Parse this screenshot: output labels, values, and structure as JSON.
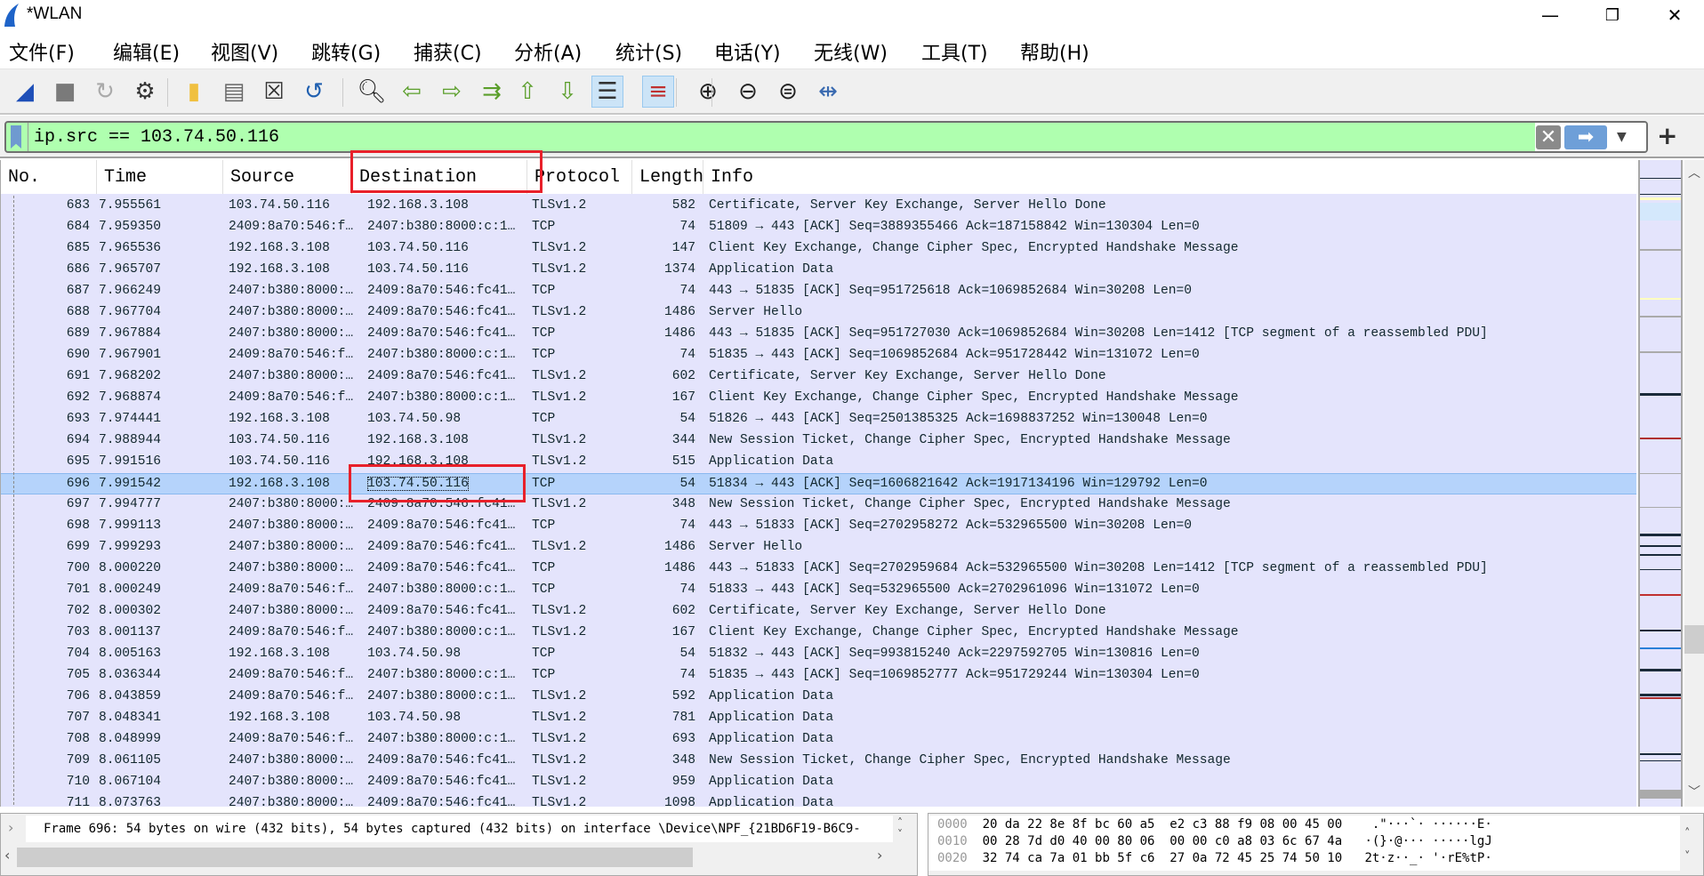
{
  "window": {
    "title": "*WLAN",
    "min_icon": "minimize-icon",
    "max_icon": "restore-icon",
    "close_icon": "close-icon"
  },
  "menu": [
    "文件(F)",
    "编辑(E)",
    "视图(V)",
    "跳转(G)",
    "捕获(C)",
    "分析(A)",
    "统计(S)",
    "电话(Y)",
    "无线(W)",
    "工具(T)",
    "帮助(H)"
  ],
  "toolbar": [
    "start-capture-icon",
    "stop-capture-icon",
    "restart-capture-icon",
    "capture-options-icon",
    "open-file-icon",
    "save-file-icon",
    "close-file-icon",
    "reload-file-icon",
    "find-packet-icon",
    "go-back-icon",
    "go-forward-icon",
    "go-to-packet-icon",
    "first-packet-icon",
    "last-packet-icon",
    "autoscroll-icon",
    "colorize-icon",
    "zoom-in-icon",
    "zoom-out-icon",
    "normal-size-icon",
    "resize-columns-icon"
  ],
  "filter": {
    "value": "ip.src == 103.74.50.116",
    "add_label": "+",
    "bg_color": "#afffaf"
  },
  "columns": [
    "No.",
    "Time",
    "Source",
    "Destination",
    "Protocol",
    "Length",
    "Info"
  ],
  "selected_no": "696",
  "packets": [
    [
      "683",
      "7.955561",
      "103.74.50.116",
      "192.168.3.108",
      "TLSv1.2",
      "582",
      "Certificate, Server Key Exchange, Server Hello Done"
    ],
    [
      "684",
      "7.959350",
      "2409:8a70:546:f…",
      "2407:b380:8000:c:1…",
      "TCP",
      "74",
      "51809 → 443 [ACK] Seq=3889355466 Ack=187158842 Win=130304 Len=0"
    ],
    [
      "685",
      "7.965536",
      "192.168.3.108",
      "103.74.50.116",
      "TLSv1.2",
      "147",
      "Client Key Exchange, Change Cipher Spec, Encrypted Handshake Message"
    ],
    [
      "686",
      "7.965707",
      "192.168.3.108",
      "103.74.50.116",
      "TLSv1.2",
      "1374",
      "Application Data"
    ],
    [
      "687",
      "7.966249",
      "2407:b380:8000:…",
      "2409:8a70:546:fc41…",
      "TCP",
      "74",
      "443 → 51835 [ACK] Seq=951725618 Ack=1069852684 Win=30208 Len=0"
    ],
    [
      "688",
      "7.967704",
      "2407:b380:8000:…",
      "2409:8a70:546:fc41…",
      "TLSv1.2",
      "1486",
      "Server Hello"
    ],
    [
      "689",
      "7.967884",
      "2407:b380:8000:…",
      "2409:8a70:546:fc41…",
      "TCP",
      "1486",
      "443 → 51835 [ACK] Seq=951727030 Ack=1069852684 Win=30208 Len=1412 [TCP segment of a reassembled PDU]"
    ],
    [
      "690",
      "7.967901",
      "2409:8a70:546:f…",
      "2407:b380:8000:c:1…",
      "TCP",
      "74",
      "51835 → 443 [ACK] Seq=1069852684 Ack=951728442 Win=131072 Len=0"
    ],
    [
      "691",
      "7.968202",
      "2407:b380:8000:…",
      "2409:8a70:546:fc41…",
      "TLSv1.2",
      "602",
      "Certificate, Server Key Exchange, Server Hello Done"
    ],
    [
      "692",
      "7.968874",
      "2409:8a70:546:f…",
      "2407:b380:8000:c:1…",
      "TLSv1.2",
      "167",
      "Client Key Exchange, Change Cipher Spec, Encrypted Handshake Message"
    ],
    [
      "693",
      "7.974441",
      "192.168.3.108",
      "103.74.50.98",
      "TCP",
      "54",
      "51826 → 443 [ACK] Seq=2501385325 Ack=1698837252 Win=130048 Len=0"
    ],
    [
      "694",
      "7.988944",
      "103.74.50.116",
      "192.168.3.108",
      "TLSv1.2",
      "344",
      "New Session Ticket, Change Cipher Spec, Encrypted Handshake Message"
    ],
    [
      "695",
      "7.991516",
      "103.74.50.116",
      "192.168.3.108",
      "TLSv1.2",
      "515",
      "Application Data"
    ],
    [
      "696",
      "7.991542",
      "192.168.3.108",
      "103.74.50.116",
      "TCP",
      "54",
      "51834 → 443 [ACK] Seq=1606821642 Ack=1917134196 Win=129792 Len=0"
    ],
    [
      "697",
      "7.994777",
      "2407:b380:8000:…",
      "2409:8a70:546:fc41…",
      "TLSv1.2",
      "348",
      "New Session Ticket, Change Cipher Spec, Encrypted Handshake Message"
    ],
    [
      "698",
      "7.999113",
      "2407:b380:8000:…",
      "2409:8a70:546:fc41…",
      "TCP",
      "74",
      "443 → 51833 [ACK] Seq=2702958272 Ack=532965500 Win=30208 Len=0"
    ],
    [
      "699",
      "7.999293",
      "2407:b380:8000:…",
      "2409:8a70:546:fc41…",
      "TLSv1.2",
      "1486",
      "Server Hello"
    ],
    [
      "700",
      "8.000220",
      "2407:b380:8000:…",
      "2409:8a70:546:fc41…",
      "TCP",
      "1486",
      "443 → 51833 [ACK] Seq=2702959684 Ack=532965500 Win=30208 Len=1412 [TCP segment of a reassembled PDU]"
    ],
    [
      "701",
      "8.000249",
      "2409:8a70:546:f…",
      "2407:b380:8000:c:1…",
      "TCP",
      "74",
      "51833 → 443 [ACK] Seq=532965500 Ack=2702961096 Win=131072 Len=0"
    ],
    [
      "702",
      "8.000302",
      "2407:b380:8000:…",
      "2409:8a70:546:fc41…",
      "TLSv1.2",
      "602",
      "Certificate, Server Key Exchange, Server Hello Done"
    ],
    [
      "703",
      "8.001137",
      "2409:8a70:546:f…",
      "2407:b380:8000:c:1…",
      "TLSv1.2",
      "167",
      "Client Key Exchange, Change Cipher Spec, Encrypted Handshake Message"
    ],
    [
      "704",
      "8.005163",
      "192.168.3.108",
      "103.74.50.98",
      "TCP",
      "54",
      "51832 → 443 [ACK] Seq=993815240 Ack=2297592705 Win=130816 Len=0"
    ],
    [
      "705",
      "8.036344",
      "2409:8a70:546:f…",
      "2407:b380:8000:c:1…",
      "TCP",
      "74",
      "51835 → 443 [ACK] Seq=1069852777 Ack=951729244 Win=130304 Len=0"
    ],
    [
      "706",
      "8.043859",
      "2409:8a70:546:f…",
      "2407:b380:8000:c:1…",
      "TLSv1.2",
      "592",
      "Application Data"
    ],
    [
      "707",
      "8.048341",
      "192.168.3.108",
      "103.74.50.98",
      "TLSv1.2",
      "781",
      "Application Data"
    ],
    [
      "708",
      "8.048999",
      "2409:8a70:546:f…",
      "2407:b380:8000:c:1…",
      "TLSv1.2",
      "693",
      "Application Data"
    ],
    [
      "709",
      "8.061105",
      "2407:b380:8000:…",
      "2409:8a70:546:fc41…",
      "TLSv1.2",
      "348",
      "New Session Ticket, Change Cipher Spec, Encrypted Handshake Message"
    ],
    [
      "710",
      "8.067104",
      "2407:b380:8000:…",
      "2409:8a70:546:fc41…",
      "TLSv1.2",
      "959",
      "Application Data"
    ],
    [
      "711",
      "8.073763",
      "2407:b380:8000:…",
      "2409:8a70:546:fc41…",
      "TLSv1.2",
      "1098",
      "Application Data"
    ]
  ],
  "colors": {
    "row_bg": "#e4e4fc",
    "selected_bg": "#b5d3fb",
    "annotation": "#e8202a"
  },
  "detail": {
    "line": "Frame 696: 54 bytes on wire (432 bits), 54 bytes captured (432 bits) on interface \\Device\\NPF_{21BD6F19-B6C9-"
  },
  "hex": [
    {
      "offset": "0000",
      "bytes": "20 da 22 8e 8f bc 60 a5  e2 c3 88 f9 08 00 45 00",
      "ascii": " .\"···`· ······E·"
    },
    {
      "offset": "0010",
      "bytes": "00 28 7d d0 40 00 80 06  00 00 c0 a8 03 6c 67 4a",
      "ascii": "·(}·@··· ·····lgJ"
    },
    {
      "offset": "0020",
      "bytes": "32 74 ca 7a 01 bb 5f c6  27 0a 72 45 25 74 50 10",
      "ascii": "2t·z··_· '·rE%tP·"
    }
  ]
}
